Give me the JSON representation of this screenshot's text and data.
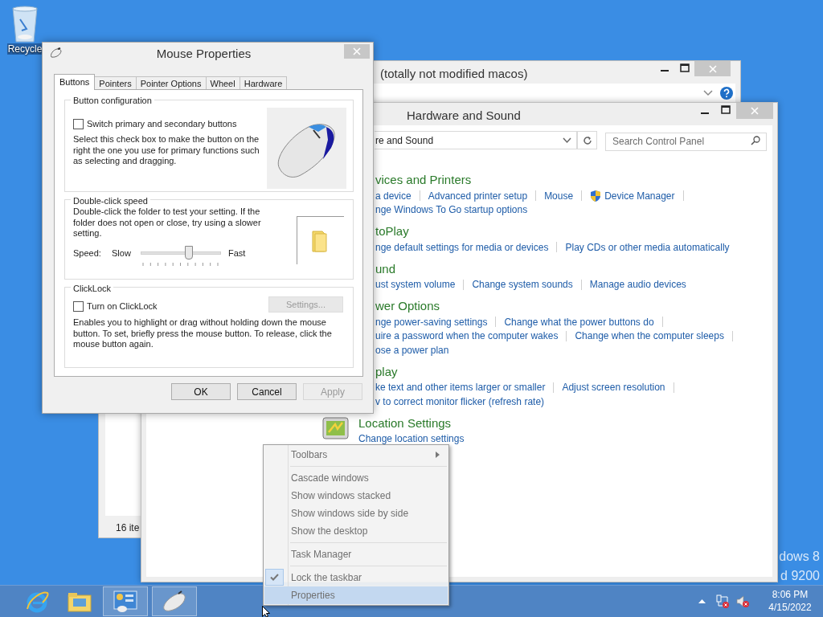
{
  "desktop": {
    "icons": [
      {
        "label": "Recycle"
      }
    ],
    "build_text": [
      "dows 8",
      "d 9200"
    ]
  },
  "explorer_window": {
    "title": "(totally not modified macos)",
    "status": "16 ite"
  },
  "control_panel": {
    "title": "Hardware and Sound",
    "address": "re and Sound",
    "search": {
      "placeholder": "Search Control Panel"
    },
    "sections": [
      {
        "heading": "vices and Printers",
        "clipped": true,
        "lines": [
          [
            {
              "text": "a device",
              "kind": "link"
            },
            {
              "text": "Advanced printer setup",
              "kind": "link"
            },
            {
              "text": "Mouse",
              "kind": "link"
            },
            {
              "text": "Device Manager",
              "kind": "admin-link"
            }
          ],
          [
            {
              "text": "nge Windows To Go startup options",
              "kind": "link"
            }
          ]
        ]
      },
      {
        "heading": "toPlay",
        "clipped": true,
        "lines": [
          [
            {
              "text": "nge default settings for media or devices",
              "kind": "link"
            },
            {
              "text": "Play CDs or other media automatically",
              "kind": "link"
            }
          ]
        ]
      },
      {
        "heading": "und",
        "clipped": true,
        "lines": [
          [
            {
              "text": "ust system volume",
              "kind": "link"
            },
            {
              "text": "Change system sounds",
              "kind": "link"
            },
            {
              "text": "Manage audio devices",
              "kind": "link"
            }
          ]
        ]
      },
      {
        "heading": "wer Options",
        "clipped": true,
        "lines": [
          [
            {
              "text": "nge power-saving settings",
              "kind": "link"
            },
            {
              "text": "Change what the power buttons do",
              "kind": "link"
            }
          ],
          [
            {
              "text": "uire a password when the computer wakes",
              "kind": "link"
            },
            {
              "text": "Change when the computer sleeps",
              "kind": "link"
            }
          ],
          [
            {
              "text": "ose a power plan",
              "kind": "link"
            }
          ]
        ]
      },
      {
        "heading": "play",
        "clipped": true,
        "lines": [
          [
            {
              "text": "ke text and other items larger or smaller",
              "kind": "link"
            },
            {
              "text": "Adjust screen resolution",
              "kind": "link"
            }
          ],
          [
            {
              "text": "v to correct monitor flicker (refresh rate)",
              "kind": "link"
            }
          ]
        ]
      },
      {
        "heading": "Location Settings",
        "clipped": false,
        "lines": [
          [
            {
              "text": "Change location settings",
              "kind": "link"
            }
          ]
        ]
      }
    ]
  },
  "mouse_properties": {
    "title": "Mouse Properties",
    "tabs": [
      {
        "label": "Buttons",
        "selected": true
      },
      {
        "label": "Pointers",
        "selected": false
      },
      {
        "label": "Pointer Options",
        "selected": false
      },
      {
        "label": "Wheel",
        "selected": false
      },
      {
        "label": "Hardware",
        "selected": false
      }
    ],
    "button_configuration": {
      "heading": "Button configuration",
      "checkbox": {
        "label": "Switch primary and secondary buttons",
        "checked": false
      },
      "description": "Select this check box to make the button on the right the one you use for primary functions such as selecting and dragging."
    },
    "double_click_speed": {
      "heading": "Double-click speed",
      "description": "Double-click the folder to test your setting. If the folder does not open or close, try using a slower setting.",
      "speed_label": "Speed:",
      "slow_label": "Slow",
      "fast_label": "Fast",
      "slider": {
        "level": 0.6
      }
    },
    "clicklock": {
      "heading": "ClickLock",
      "checkbox": {
        "label": "Turn on ClickLock",
        "checked": false
      },
      "settings_button": {
        "label": "Settings...",
        "disabled": true
      },
      "description": "Enables you to highlight or drag without holding down the mouse button. To set, briefly press the mouse button. To release, click the mouse button again."
    },
    "buttons": [
      {
        "label": "OK",
        "disabled": false
      },
      {
        "label": "Cancel",
        "disabled": false
      },
      {
        "label": "Apply",
        "disabled": true
      }
    ]
  },
  "context_menu": {
    "groups": [
      [
        {
          "label": "Toolbars",
          "kind": "submenu",
          "checked": false,
          "selected": false
        }
      ],
      [
        {
          "label": "Cascade windows",
          "kind": "item",
          "checked": false,
          "selected": false
        },
        {
          "label": "Show windows stacked",
          "kind": "item",
          "checked": false,
          "selected": false
        },
        {
          "label": "Show windows side by side",
          "kind": "item",
          "checked": false,
          "selected": false
        },
        {
          "label": "Show the desktop",
          "kind": "item",
          "checked": false,
          "selected": false
        }
      ],
      [
        {
          "label": "Task Manager",
          "kind": "item",
          "checked": false,
          "selected": false
        }
      ],
      [
        {
          "label": "Lock the taskbar",
          "kind": "item",
          "checked": true,
          "selected": false
        },
        {
          "label": "Properties",
          "kind": "item",
          "checked": false,
          "selected": true
        }
      ]
    ]
  },
  "taskbar": {
    "buttons": [
      {
        "kind": "browser",
        "running": false
      },
      {
        "kind": "file-manager",
        "running": false
      },
      {
        "kind": "control-panel",
        "running": true
      },
      {
        "kind": "mouse-settings",
        "running": true
      }
    ],
    "clock": {
      "time": "8:06 PM",
      "date": "4/15/2022"
    }
  }
}
